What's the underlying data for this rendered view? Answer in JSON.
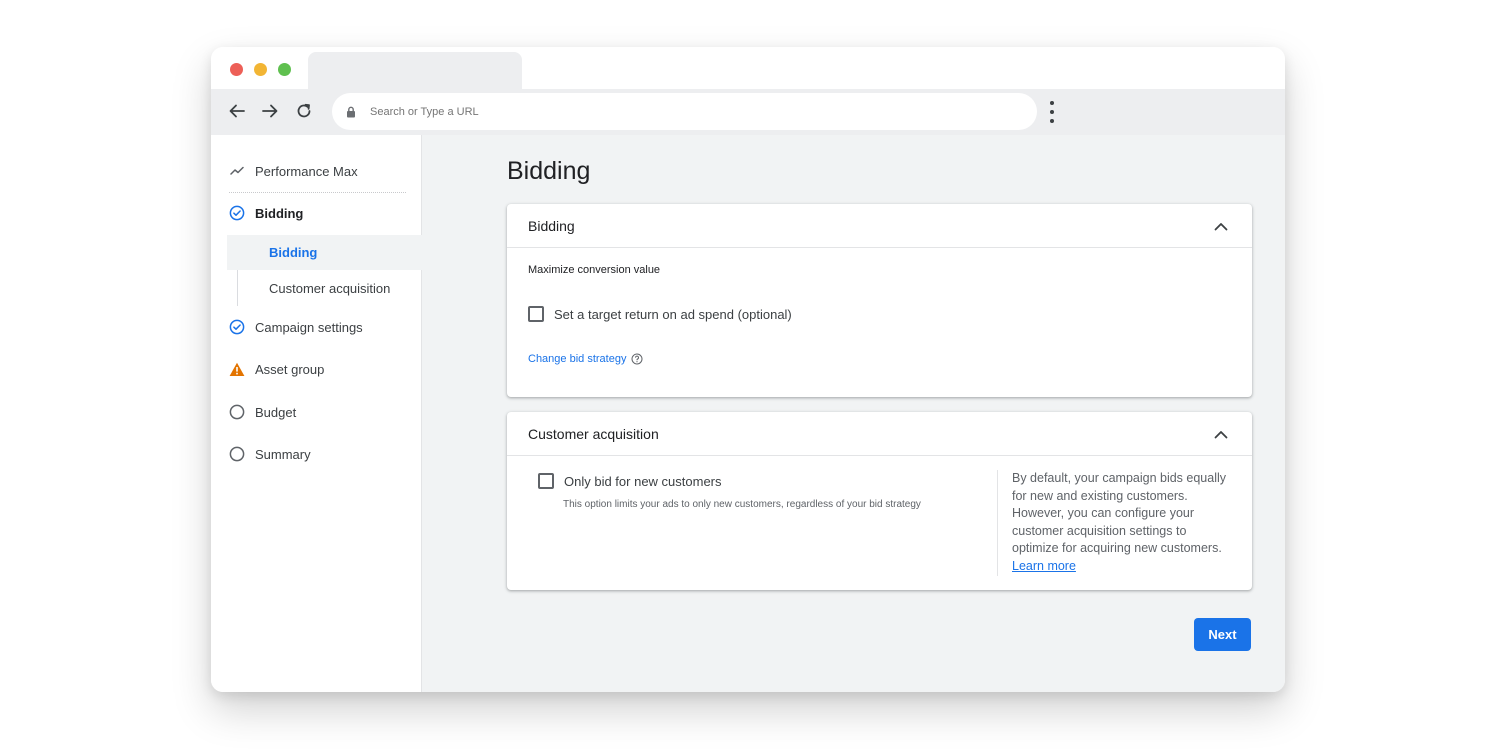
{
  "browser": {
    "url_placeholder": "Search or Type a URL"
  },
  "sidebar": {
    "header_label": "Performance Max",
    "items": [
      {
        "label": "Bidding",
        "status": "complete"
      },
      {
        "label": "Campaign settings",
        "status": "complete"
      },
      {
        "label": "Asset group",
        "status": "warning"
      },
      {
        "label": "Budget",
        "status": "incomplete"
      },
      {
        "label": "Summary",
        "status": "incomplete"
      }
    ],
    "subitems": [
      {
        "label": "Bidding",
        "active": true
      },
      {
        "label": "Customer acquisition",
        "active": false
      }
    ]
  },
  "main": {
    "page_title": "Bidding",
    "bidding_card": {
      "title": "Bidding",
      "strategy_label": "Maximize conversion value",
      "target_roas_label": "Set a target return on ad spend (optional)",
      "target_roas_checked": false,
      "change_strategy_link": "Change bid strategy"
    },
    "customer_card": {
      "title": "Customer acquisition",
      "checkbox_label": "Only bid for new customers",
      "checkbox_checked": false,
      "checkbox_hint": "This option limits your ads to only new customers, regardless of your bid strategy",
      "info_text": "By default, your campaign bids equally for new and existing customers. However, you can configure your customer acquisition settings to optimize for acquiring new customers.",
      "learn_more": "Learn more"
    },
    "next_label": "Next"
  },
  "colors": {
    "accent": "#1a73e8",
    "complete": "#1a73e8",
    "warning": "#e37400",
    "incomplete": "#5f6368",
    "page_background": "#f1f3f4"
  }
}
